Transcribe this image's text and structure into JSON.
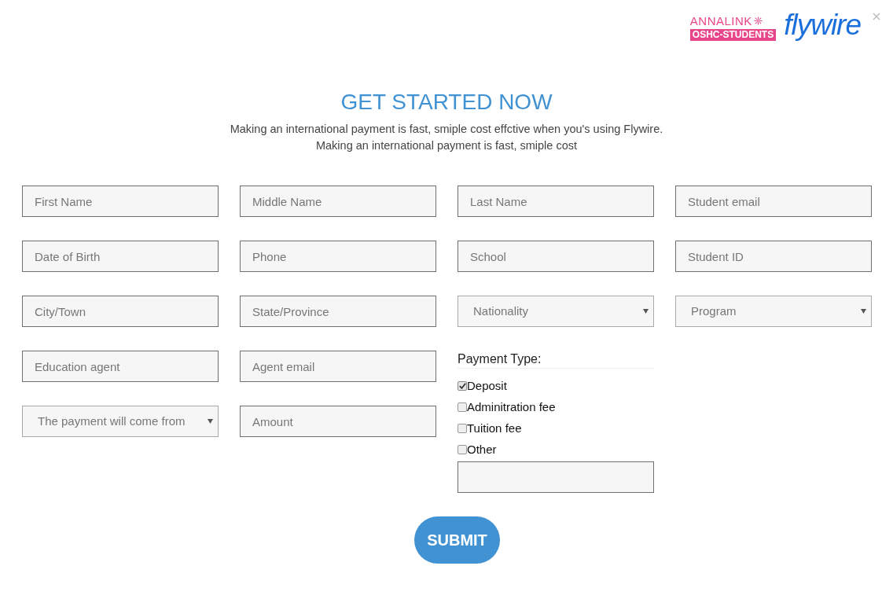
{
  "header": {
    "partner_logo": {
      "name": "ANNALINK",
      "tagline": "OSHC-STUDENTS"
    },
    "brand_logo": {
      "name": "flywire"
    }
  },
  "title": "GET STARTED NOW",
  "intro": [
    "Making an international payment is fast, smiple cost effctive when you's using Flywire.",
    "Making an international payment is fast, smiple cost"
  ],
  "fields": [
    {
      "kind": "input",
      "placeholder": "First Name"
    },
    {
      "kind": "input",
      "placeholder": "Middle Name"
    },
    {
      "kind": "input",
      "placeholder": "Last Name"
    },
    {
      "kind": "input",
      "placeholder": "Student email"
    },
    {
      "kind": "input",
      "placeholder": "Date of Birth"
    },
    {
      "kind": "input",
      "placeholder": "Phone"
    },
    {
      "kind": "input",
      "placeholder": "School"
    },
    {
      "kind": "input",
      "placeholder": "Student ID"
    },
    {
      "kind": "input",
      "placeholder": "City/Town"
    },
    {
      "kind": "input",
      "placeholder": "State/Province"
    },
    {
      "kind": "select",
      "placeholder": "Nationality"
    },
    {
      "kind": "select",
      "placeholder": "Program"
    }
  ],
  "lower_fields": [
    {
      "kind": "input",
      "placeholder": "Education agent"
    },
    {
      "kind": "input",
      "placeholder": "Agent email"
    },
    {
      "kind": "select",
      "placeholder": "The payment will come from"
    },
    {
      "kind": "input",
      "placeholder": "Amount"
    }
  ],
  "payment_type": {
    "label": "Payment Type:",
    "options": [
      {
        "label": "Deposit",
        "checked": true
      },
      {
        "label": "Adminitration fee",
        "checked": false
      },
      {
        "label": "Tuition fee",
        "checked": false
      },
      {
        "label": "Other",
        "checked": false
      }
    ]
  },
  "submit": "SUBMIT"
}
